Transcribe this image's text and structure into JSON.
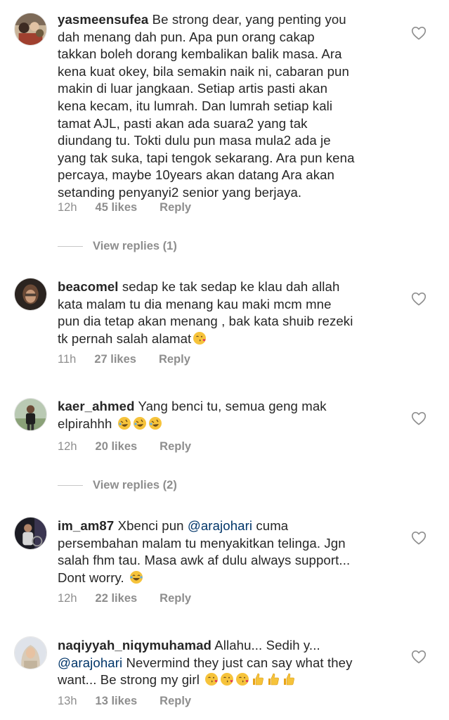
{
  "comments": [
    {
      "username": "yasmeensufea",
      "lines": [
        " Be strong dear, yang penting you",
        "dah menang dah pun. Apa pun orang cakap",
        "takkan boleh dorang kembalikan balik masa. Ara",
        "kena kuat okey, bila semakin naik ni, cabaran pun",
        "makin di luar jangkaan. Setiap artis pasti akan",
        "kena kecam, itu lumrah. Dan lumrah setiap kali",
        "tamat AJL, pasti akan ada suara2 yang tak",
        "diundang tu. Tokti dulu pun masa mula2 ada je",
        "yang tak suka, tapi tengok sekarang. Ara pun kena",
        "percaya, maybe 10years akan datang Ara akan",
        "setanding penyanyi2 senior yang berjaya."
      ],
      "time": "12h",
      "likes": "45 likes",
      "reply": "Reply",
      "view_replies": "View replies (1)"
    },
    {
      "username": "beacomel",
      "lines": [
        " sedap ke tak sedap ke klau dah allah",
        "kata malam tu dia menang kau maki mcm mne",
        "pun dia tetap akan menang , bak kata shuib rezeki",
        "tk pernah salah alamat"
      ],
      "emoji": "😘",
      "time": "11h",
      "likes": "27 likes",
      "reply": "Reply"
    },
    {
      "username": "kaer_ahmed",
      "lines": [
        " Yang benci tu, semua geng mak",
        "elpirahhh "
      ],
      "emoji": "🤣🤣🤣",
      "time": "12h",
      "likes": "20 likes",
      "reply": "Reply",
      "view_replies": "View replies (2)"
    },
    {
      "username": "im_am87",
      "line1_pre": " Xbenci pun ",
      "mention": "@arajohari",
      "line1_post": "  cuma",
      "lines": [
        "persembahan malam tu menyakitkan telinga. Jgn",
        "salah fhm tau. Masa awk af dulu always support...",
        "Dont worry. "
      ],
      "emoji": "😂",
      "time": "12h",
      "likes": "22 likes",
      "reply": "Reply"
    },
    {
      "username": "naqiyyah_niqymuhamad",
      "line1_post": " Allahu... Sedih y...",
      "mention": "@arajohari",
      "line2_post": " Nevermind they just can say what they",
      "line3": "want... Be strong my girl ",
      "emoji": "😘😘😘👍👍👍",
      "time": "13h",
      "likes": "13 likes",
      "reply": "Reply"
    }
  ],
  "colors": {
    "text": "#262626",
    "meta": "#8e8e8e",
    "mention": "#003569",
    "divider": "#c7c7c7"
  },
  "icons": {
    "like": "heart-outline-icon"
  }
}
